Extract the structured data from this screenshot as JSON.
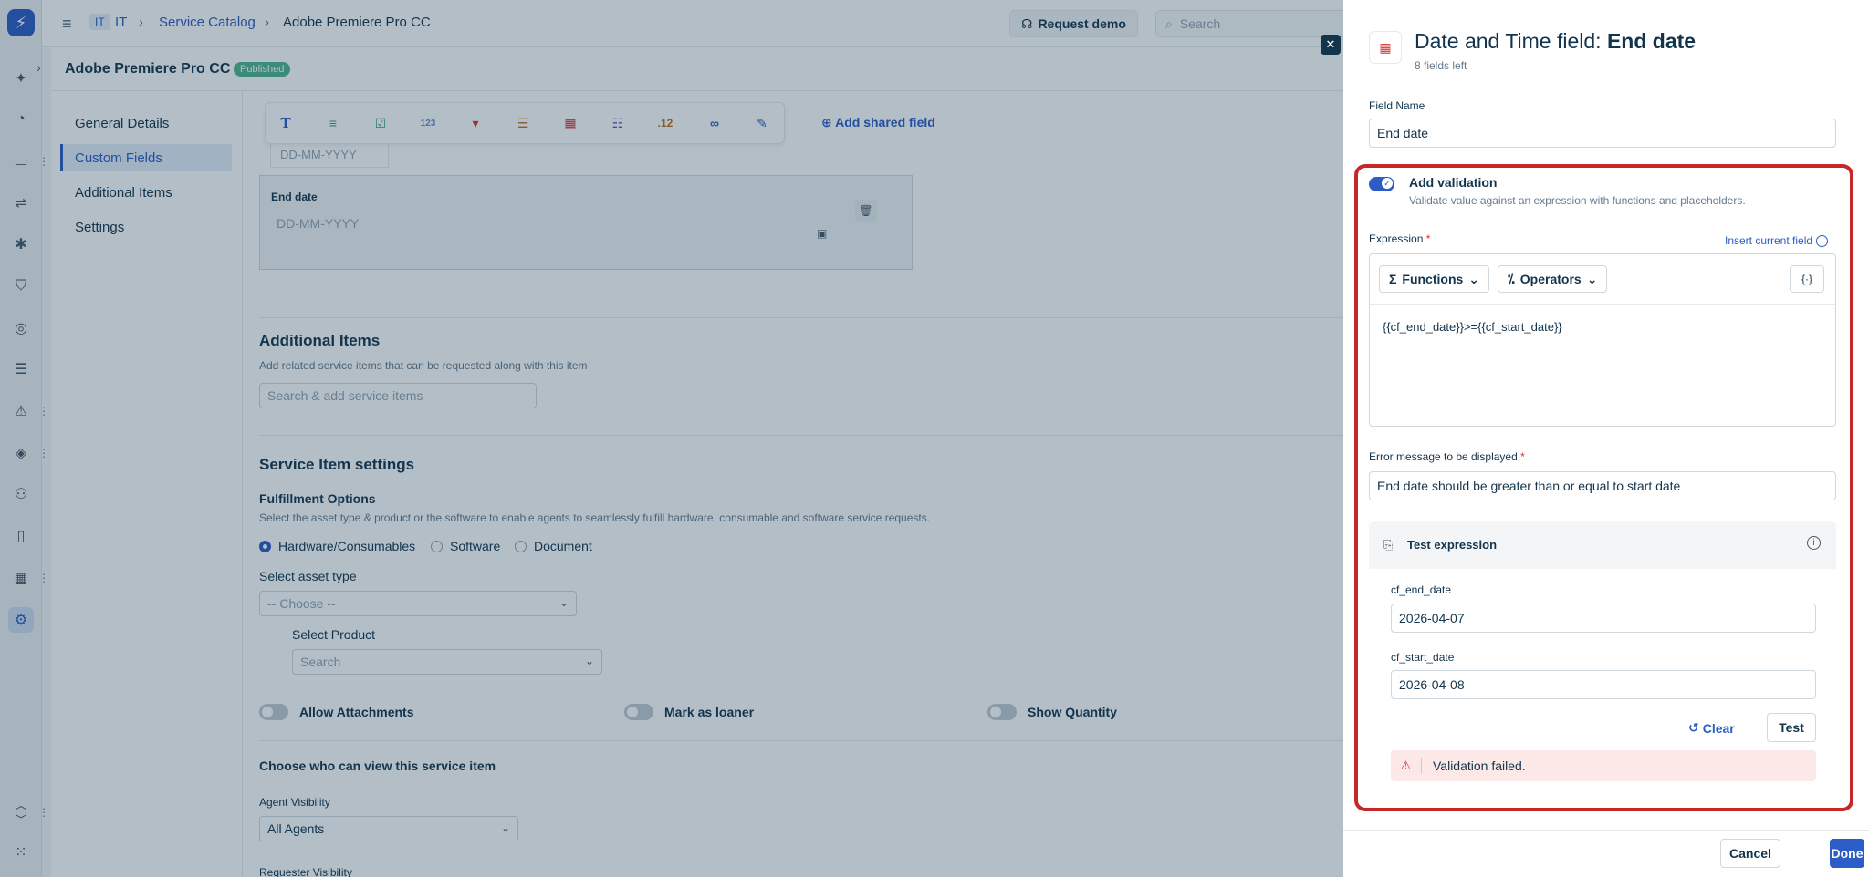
{
  "header": {
    "workspace_badge": "IT",
    "workspace": "IT",
    "breadcrumb": [
      "Service Catalog",
      "Adobe Premiere Pro CC"
    ],
    "request_demo": "Request demo",
    "search_placeholder": "Search"
  },
  "page": {
    "title": "Adobe Premiere Pro CC",
    "status": "Published"
  },
  "leftnav": {
    "items": [
      {
        "label": "General Details"
      },
      {
        "label": "Custom Fields"
      },
      {
        "label": "Additional Items"
      },
      {
        "label": "Settings"
      }
    ]
  },
  "main": {
    "toolbar_icons": [
      "text-icon",
      "paragraph-icon",
      "checkbox-icon",
      "number-icon",
      "dropdown-icon",
      "multiline-icon",
      "date-icon",
      "list-icon",
      "decimal-icon",
      "link-icon",
      "edit-icon"
    ],
    "toolbar_number": "123",
    "toolbar_decimal": ".12",
    "add_shared_field": "Add shared field",
    "date_placeholder": "DD-MM-YYYY",
    "end_date_card": {
      "label": "End date",
      "placeholder": "DD-MM-YYYY"
    },
    "additional_items": {
      "title": "Additional Items",
      "subtitle": "Add related service items that can be requested along with this item",
      "search_placeholder": "Search & add service items"
    },
    "service_settings": {
      "title": "Service Item settings",
      "fulfillment_title": "Fulfillment Options",
      "fulfillment_sub": "Select the asset type & product or the software to enable agents to seamlessly fulfill hardware, consumable and software service requests.",
      "radios": [
        "Hardware/Consumables",
        "Software",
        "Document"
      ],
      "asset_type_label": "Select asset type",
      "asset_type_value": "-- Choose --",
      "product_label": "Select Product",
      "product_placeholder": "Search",
      "toggles": [
        "Allow Attachments",
        "Mark as loaner",
        "Show Quantity"
      ],
      "visibility_title": "Choose who can view this service item",
      "agent_visibility_label": "Agent Visibility",
      "agent_visibility_value": "All Agents",
      "requester_visibility_label": "Requester Visibility"
    }
  },
  "drawer": {
    "title_prefix": "Date and Time field: ",
    "title_field": "End date",
    "fields_left": "8 fields left",
    "field_name_label": "Field Name",
    "field_name_value": "End date",
    "validation_title": "Add validation",
    "validation_sub": "Validate value against an expression with functions and placeholders.",
    "expression_label": "Expression",
    "required_mark": "*",
    "insert_current_field": "Insert current field",
    "functions_btn": "Functions",
    "operators_btn": "Operators",
    "placeholder_btn": "{·}",
    "expression_value": "{{cf_end_date}}>={{cf_start_date}}",
    "error_label": "Error message to be displayed",
    "error_value": "End date should be greater than or equal to start date",
    "test_title": "Test expression",
    "test_fields": [
      {
        "label": "cf_end_date",
        "value": "2026-04-07"
      },
      {
        "label": "cf_start_date",
        "value": "2026-04-08"
      }
    ],
    "clear_btn": "Clear",
    "test_btn": "Test",
    "result_message": "Validation failed.",
    "cancel_btn": "Cancel",
    "done_btn": "Done"
  },
  "colors": {
    "primary": "#2c5cc5",
    "highlight_border": "#c62828",
    "error_bg": "#fde8e8",
    "published": "#4fb58c"
  }
}
